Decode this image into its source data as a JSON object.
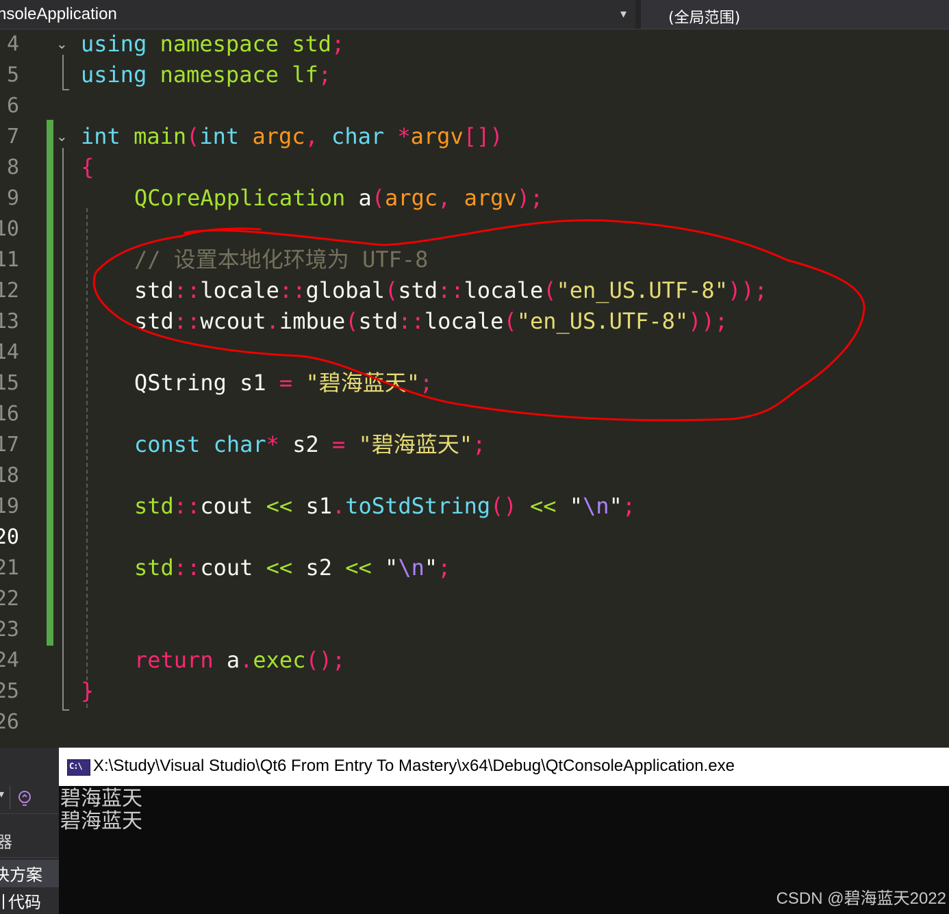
{
  "navbar": {
    "project": "nsoleApplication",
    "scope": "(全局范围)"
  },
  "editor": {
    "line_numbers": [
      "4",
      "5",
      "6",
      "7",
      "8",
      "9",
      "10",
      "11",
      "12",
      "13",
      "14",
      "15",
      "16",
      "17",
      "18",
      "19",
      "20",
      "21",
      "22",
      "23",
      "24",
      "25",
      "26"
    ],
    "current_line": "20",
    "code": {
      "l4": {
        "using": "using",
        "namespace": "namespace",
        "name": "std",
        "semi": ";"
      },
      "l5": {
        "using": "using",
        "namespace": "namespace",
        "name": "lf",
        "semi": ";"
      },
      "l7": {
        "int": "int",
        "main": "main",
        "open": "(",
        "int2": "int",
        "argc": "argc",
        "comma": ",",
        "char": "char",
        "star": "*",
        "argv": "argv",
        "brackets": "[]",
        "close": ")"
      },
      "l8": {
        "brace": "{"
      },
      "l9": {
        "type": "QCoreApplication",
        "var": "a",
        "open": "(",
        "argc": "argc",
        "comma": ",",
        "argv": "argv",
        "close": ");"
      },
      "l11": {
        "comment": "// 设置本地化环境为 UTF-8"
      },
      "l12": {
        "std1": "std",
        "sep1": "::",
        "locale1": "locale",
        "sep2": "::",
        "global": "global",
        "open1": "(",
        "std2": "std",
        "sep3": "::",
        "locale2": "locale",
        "open2": "(",
        "str": "\"en_US.UTF-8\"",
        "close": "));"
      },
      "l13": {
        "std1": "std",
        "sep1": "::",
        "wcout": "wcout",
        "dot": ".",
        "imbue": "imbue",
        "open1": "(",
        "std2": "std",
        "sep2": "::",
        "locale": "locale",
        "open2": "(",
        "str": "\"en_US.UTF-8\"",
        "close": "));"
      },
      "l15": {
        "type": "QString",
        "var": "s1",
        "eq": "=",
        "str": "\"碧海蓝天\"",
        "semi": ";"
      },
      "l17": {
        "const": "const",
        "char": "char",
        "star": "*",
        "var": "s2",
        "eq": "=",
        "str": "\"碧海蓝天\"",
        "semi": ";"
      },
      "l19": {
        "std": "std",
        "sep": "::",
        "cout": "cout",
        "op1": "<<",
        "s1": "s1",
        "dot": ".",
        "method": "toStdString",
        "parens": "()",
        "op2": "<<",
        "q1": "\"",
        "esc": "\\n",
        "q2": "\"",
        "semi": ";"
      },
      "l21": {
        "std": "std",
        "sep": "::",
        "cout": "cout",
        "op1": "<<",
        "s2": "s2",
        "op2": "<<",
        "q1": "\"",
        "esc": "\\n",
        "q2": "\"",
        "semi": ";"
      },
      "l24": {
        "return": "return",
        "var": "a",
        "dot": ".",
        "exec": "exec",
        "parens": "()",
        "semi": ";"
      },
      "l25": {
        "brace": "}"
      }
    },
    "annotation_color": "#ee0000"
  },
  "sidebar": {
    "item1": "器",
    "solution": "决方案",
    "code": "代码"
  },
  "console": {
    "title": "X:\\Study\\Visual Studio\\Qt6 From Entry To Mastery\\x64\\Debug\\QtConsoleApplication.exe",
    "icon_text": "C:\\",
    "output": [
      "碧海蓝天",
      "碧海蓝天"
    ]
  },
  "watermark": "CSDN @碧海蓝天2022"
}
